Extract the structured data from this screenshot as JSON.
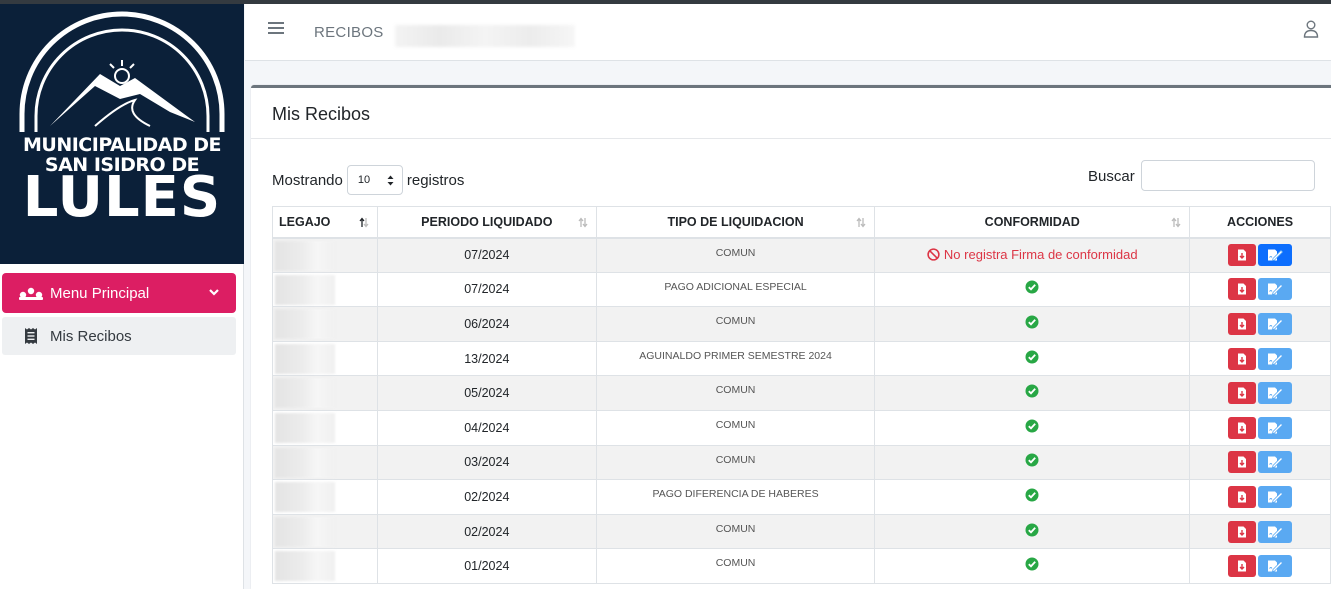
{
  "brand": {
    "line1": "MUNICIPALIDAD DE",
    "line2": "SAN ISIDRO DE",
    "line3": "LULES",
    "colors": {
      "sidebar_logo_bg": "#0b2039",
      "accent": "#dc1e63"
    }
  },
  "sidebar": {
    "menu_main": {
      "label": "Menu Principal",
      "icon": "sitemap-icon"
    },
    "items": [
      {
        "label": "Mis Recibos",
        "icon": "receipt-icon"
      }
    ]
  },
  "header": {
    "breadcrumb": "RECIBOS"
  },
  "card": {
    "title": "Mis Recibos",
    "length_prefix": "Mostrando",
    "length_value": "10",
    "length_suffix": "registros",
    "search_label": "Buscar",
    "search_value": ""
  },
  "table": {
    "columns": [
      "LEGAJO",
      "PERIODO LIQUIDADO",
      "TIPO DE LIQUIDACION",
      "CONFORMIDAD",
      "ACCIONES"
    ],
    "rows": [
      {
        "periodo": "07/2024",
        "tipo": "COMUN",
        "conformidad": "No registra Firma de conformidad",
        "signed": false
      },
      {
        "periodo": "07/2024",
        "tipo": "PAGO ADICIONAL ESPECIAL",
        "conformidad": "",
        "signed": true
      },
      {
        "periodo": "06/2024",
        "tipo": "COMUN",
        "conformidad": "",
        "signed": true
      },
      {
        "periodo": "13/2024",
        "tipo": "AGUINALDO PRIMER SEMESTRE 2024",
        "conformidad": "",
        "signed": true
      },
      {
        "periodo": "05/2024",
        "tipo": "COMUN",
        "conformidad": "",
        "signed": true
      },
      {
        "periodo": "04/2024",
        "tipo": "COMUN",
        "conformidad": "",
        "signed": true
      },
      {
        "periodo": "03/2024",
        "tipo": "COMUN",
        "conformidad": "",
        "signed": true
      },
      {
        "periodo": "02/2024",
        "tipo": "PAGO DIFERENCIA DE HABERES",
        "conformidad": "",
        "signed": true
      },
      {
        "periodo": "02/2024",
        "tipo": "COMUN",
        "conformidad": "",
        "signed": true
      },
      {
        "periodo": "01/2024",
        "tipo": "COMUN",
        "conformidad": "",
        "signed": true
      }
    ]
  }
}
